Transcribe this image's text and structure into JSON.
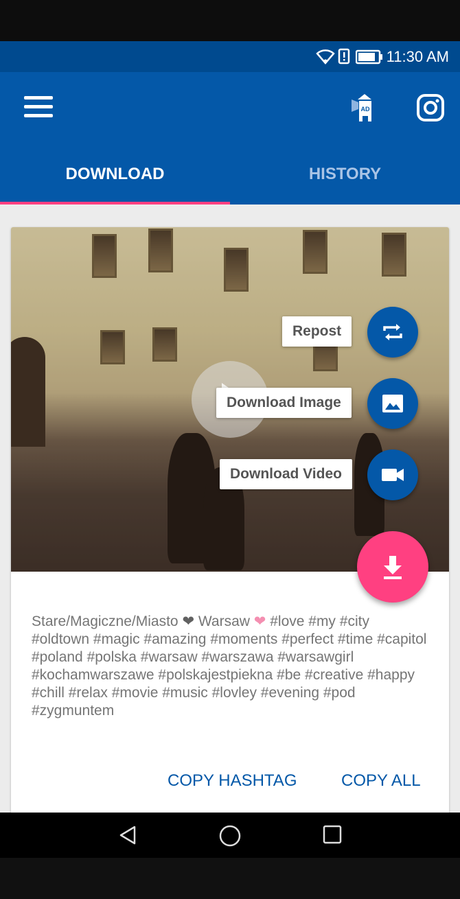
{
  "status_bar": {
    "time": "11:30 AM"
  },
  "tabs": [
    {
      "label": "DOWNLOAD"
    },
    {
      "label": "HISTORY"
    }
  ],
  "fab_actions": {
    "repost": "Repost",
    "download_image": "Download Image",
    "download_video": "Download Video"
  },
  "caption": {
    "part1": "Stare/Magiczne/Miasto ",
    "heart1": "❤",
    "part2": " Warsaw ",
    "heart2": "❤",
    "part3": " #love #my #city #oldtown #magic #amazing #moments #perfect #time #capitol #poland #polska #warsaw #warszawa #warsawgirl #kochamwarszawe #polskajestpiekna #be #creative #happy #chill #relax #movie #music #lovley #evening #pod #zygmuntem"
  },
  "actions": {
    "copy_hashtag": "COPY HASHTAG",
    "copy_all": "COPY ALL"
  },
  "colors": {
    "primary": "#0458a8",
    "primary_dark": "#004a8f",
    "accent": "#ff4081"
  },
  "icons": [
    "menu-icon",
    "ad-tower-icon",
    "instagram-icon",
    "repost-icon",
    "image-icon",
    "video-icon",
    "download-icon",
    "back-icon",
    "home-icon",
    "recents-icon"
  ]
}
